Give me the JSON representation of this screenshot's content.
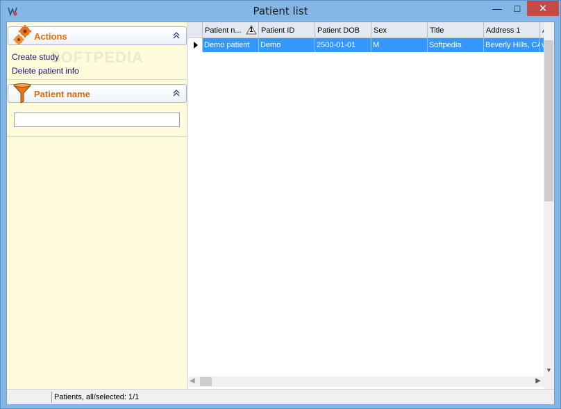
{
  "window": {
    "title": "Patient list",
    "minimize_glyph": "—",
    "maximize_glyph": "□",
    "close_glyph": "✕"
  },
  "sidebar": {
    "actions_panel": {
      "title": "Actions",
      "icon": "gears-icon",
      "items": [
        {
          "label": "Create study"
        },
        {
          "label": "Delete patient info"
        }
      ]
    },
    "filter_panel": {
      "title": "Patient name",
      "icon": "funnel-icon",
      "input_value": ""
    },
    "watermark": "SOFTPEDIA"
  },
  "grid": {
    "columns": [
      {
        "label": "Patient n...",
        "sort_indicator": "1"
      },
      {
        "label": "Patient ID"
      },
      {
        "label": "Patient DOB"
      },
      {
        "label": "Sex"
      },
      {
        "label": "Title"
      },
      {
        "label": "Address 1"
      },
      {
        "label": "A"
      }
    ],
    "rows": [
      {
        "selected": true,
        "cells": [
          "Demo patient",
          "Demo",
          "2500-01-01",
          "M",
          "Softpedia",
          "Beverly Hills, CA",
          "v"
        ]
      }
    ]
  },
  "statusbar": {
    "text": "Patients, all/selected: 1/1"
  },
  "colors": {
    "titlebar": "#84B7E6",
    "selection": "#3399FF",
    "sidebar_bg": "#FFFCDC",
    "panel_title": "#E46C0A",
    "close_button": "#C74B45"
  }
}
